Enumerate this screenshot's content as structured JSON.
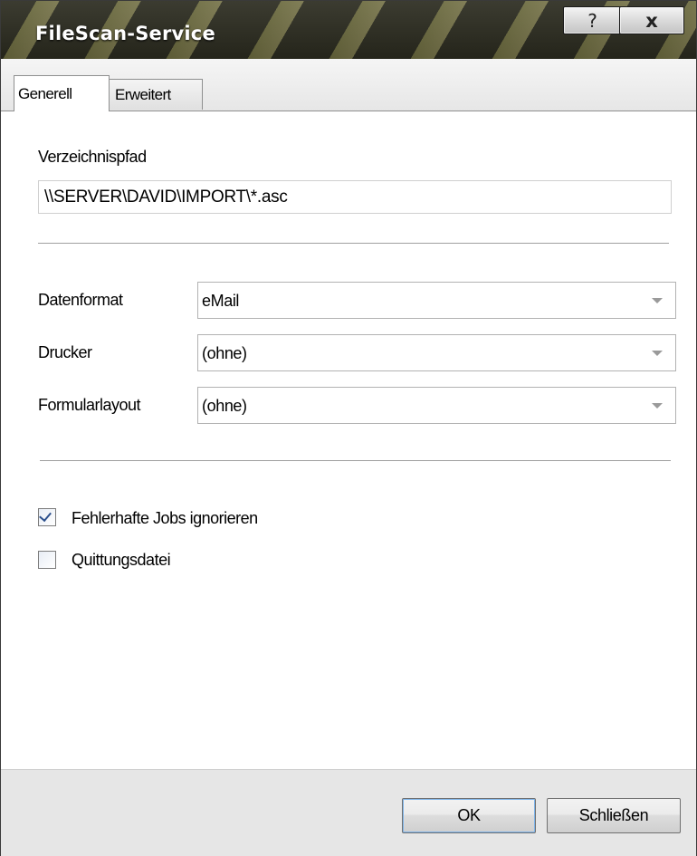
{
  "window": {
    "title": "FileScan-Service",
    "help_label": "?",
    "close_label": "x"
  },
  "tabs": [
    {
      "label": "Generell",
      "active": true
    },
    {
      "label": "Erweitert",
      "active": false
    }
  ],
  "path": {
    "label": "Verzeichnispfad",
    "value": "\\\\SERVER\\DAVID\\IMPORT\\*.asc"
  },
  "fields": {
    "datenformat": {
      "label": "Datenformat",
      "value": "eMail"
    },
    "drucker": {
      "label": "Drucker",
      "value": "(ohne)"
    },
    "formularlayout": {
      "label": "Formularlayout",
      "value": "(ohne)"
    }
  },
  "options": {
    "fehlerhafte": {
      "label": "Fehlerhafte Jobs ignorieren",
      "checked": true
    },
    "quittung": {
      "label": "Quittungsdatei",
      "checked": false
    }
  },
  "buttons": {
    "ok": "OK",
    "close": "Schließen"
  }
}
